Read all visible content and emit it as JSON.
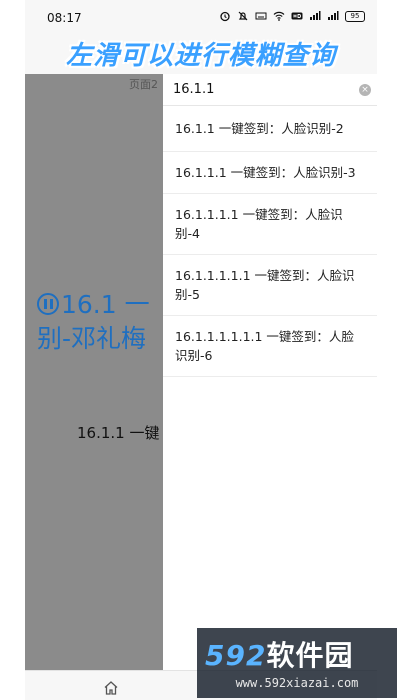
{
  "status_bar": {
    "time": "08:17",
    "battery": "95"
  },
  "banner": {
    "text": "左滑可以进行模糊查询"
  },
  "background_page": {
    "page_label": "页面2",
    "title_line1": "16.1 一",
    "title_line2": "别-邓礼梅",
    "subtitle": "16.1.1 一键"
  },
  "search": {
    "value": "16.1.1"
  },
  "results": [
    "16.1.1 一键签到：人脸识别-2",
    "16.1.1.1 一键签到：人脸识别-3",
    "16.1.1.1.1 一键签到：人脸识别-4",
    "16.1.1.1.1.1 一键签到：人脸识别-5",
    "16.1.1.1.1.1.1 一键签到：人脸识别-6"
  ],
  "watermark": {
    "logo_num": "592",
    "logo_text": "软件园",
    "url": "www.592xiazai.com"
  },
  "colors": {
    "accent": "#3aa0ff",
    "title_blue": "#1f6fc0",
    "dim": "#8b8b8b"
  }
}
